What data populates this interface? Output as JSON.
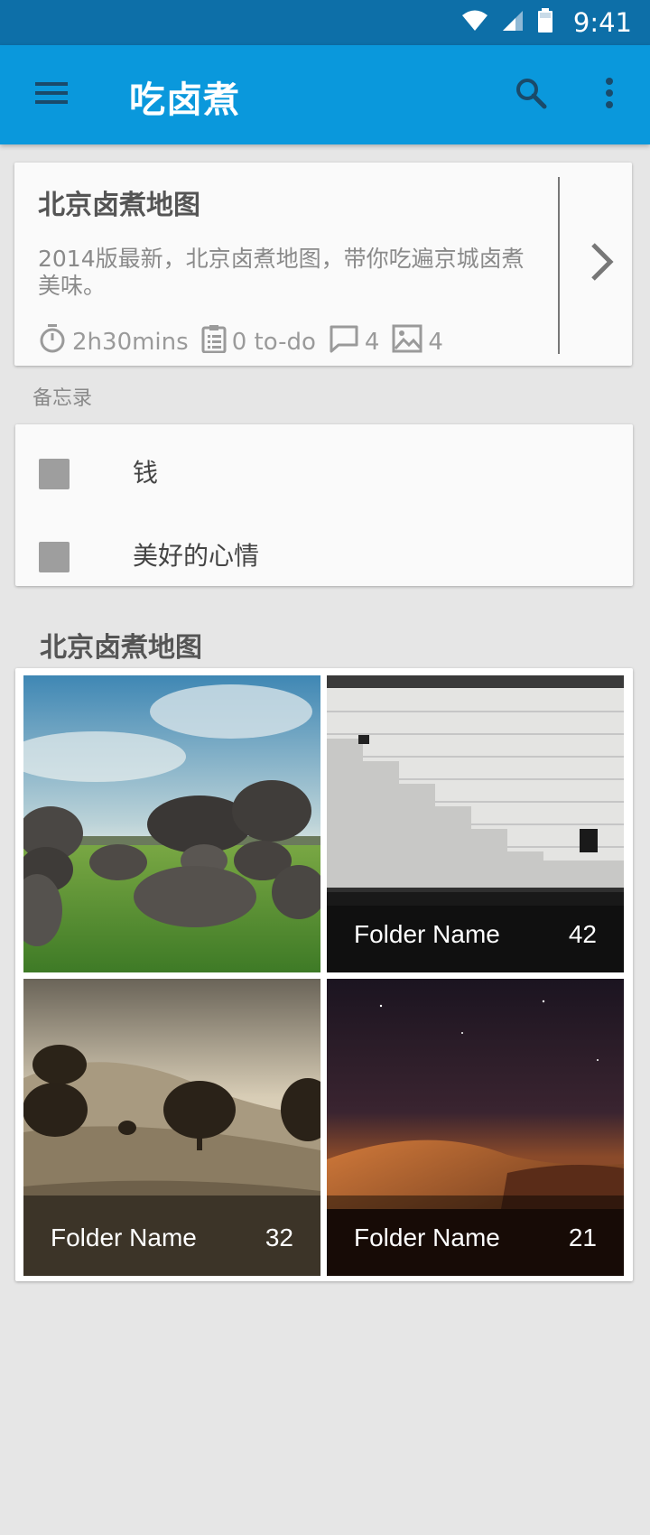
{
  "status_bar": {
    "time": "9:41",
    "icons": [
      "wifi-icon",
      "signal-icon",
      "battery-icon"
    ]
  },
  "app_bar": {
    "title": "吃卤煮",
    "color": "#0a98dc",
    "icons": [
      "menu-icon",
      "search-icon",
      "more-vert-icon"
    ]
  },
  "summary_card": {
    "title": "北京卤煮地图",
    "description": "2014版最新，北京卤煮地图，带你吃遍京城卤煮美味。",
    "stats": [
      {
        "icon": "timer-icon",
        "value": "2h30mins"
      },
      {
        "icon": "clipboard-icon",
        "value": "0 to-do"
      },
      {
        "icon": "comment-icon",
        "value": "4"
      },
      {
        "icon": "image-icon",
        "value": "4"
      }
    ]
  },
  "memo": {
    "label": "备忘录",
    "items": [
      {
        "text": "钱",
        "checked": false
      },
      {
        "text": "美好的心情",
        "checked": false
      }
    ]
  },
  "gallery": {
    "title": "北京卤煮地图",
    "folders": [
      {
        "photo": "stones-field",
        "name": "",
        "count": ""
      },
      {
        "photo": "stone-steps",
        "name": "Folder Name",
        "count": "42"
      },
      {
        "photo": "sepia-hills",
        "name": "Folder Name",
        "count": "32"
      },
      {
        "photo": "desert-night",
        "name": "Folder Name",
        "count": "21"
      }
    ]
  }
}
